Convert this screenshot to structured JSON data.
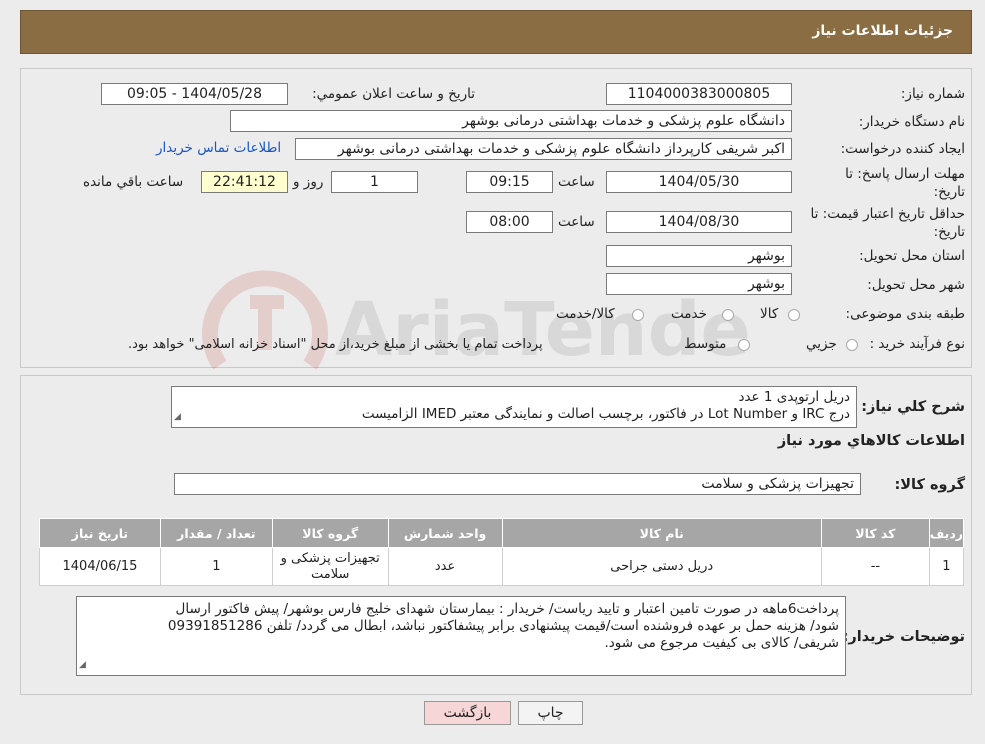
{
  "header": {
    "title": "جزئیات اطلاعات نیاز"
  },
  "form": {
    "need_number_label": "شماره نیاز:",
    "need_number": "1104000383000805",
    "announce_label": "تاریخ و ساعت اعلان عمومي:",
    "announce_value": "1404/05/28 - 09:05",
    "buyer_org_label": "نام دستگاه خريدار:",
    "buyer_org": "دانشگاه علوم پزشکی و خدمات بهداشتی درمانی بوشهر",
    "creator_label": "ايجاد كننده درخواست:",
    "creator": "اکبر شریفی کارپرداز دانشگاه علوم پزشکی و خدمات بهداشتی درمانی بوشهر",
    "contact_link": "اطلاعات تماس خريدار",
    "deadline_label_1": "مهلت ارسال پاسخ: تا",
    "deadline_label_2": "تاریخ:",
    "deadline_date": "1404/05/30",
    "time_label": "ساعت",
    "deadline_time": "09:15",
    "days_value": "1",
    "days_label": "روز و",
    "remaining_time": "22:41:12",
    "remaining_label": "ساعت باقي مانده",
    "validity_label_1": "حداقل تاریخ اعتبار قیمت: تا",
    "validity_label_2": "تاریخ:",
    "validity_date": "1404/08/30",
    "validity_time": "08:00",
    "province_label": "استان محل تحويل:",
    "province": "بوشهر",
    "city_label": "شهر محل تحويل:",
    "city": "بوشهر",
    "category_label": "طبقه بندی موضوعی:",
    "category_options": [
      "کالا",
      "خدمت",
      "کالا/خدمت"
    ],
    "process_label": "نوع فرآيند خريد :",
    "process_options": [
      "جزيي",
      "متوسط"
    ],
    "process_note": "پرداخت تمام يا بخشی از مبلغ خريد،از محل \"اسناد خزانه اسلامی\" خواهد بود."
  },
  "details": {
    "summary_label": "شرح كلي نياز:",
    "summary_lines": [
      "دریل ارتوپدی 1 عدد",
      "درج IRC و Lot Number در فاکتور، برچسب اصالت و نمایندگی معتبر IMED الزامیست"
    ],
    "goods_info_label": "اطلاعات كالاهاي مورد نياز",
    "goods_group_label": "گروه کالا:",
    "goods_group": "تجهیزات پزشکی و سلامت",
    "table": {
      "headers": [
        "رديف",
        "كد كالا",
        "نام كالا",
        "واحد شمارش",
        "گروه كالا",
        "تعداد / مقدار",
        "تاريخ نياز"
      ],
      "rows": [
        [
          "1",
          "--",
          "دریل دستی جراحی",
          "عدد",
          "تجهیزات پزشکی و سلامت",
          "1",
          "1404/06/15"
        ]
      ]
    },
    "buyer_notes_label": "توضيحات خريدار:",
    "buyer_notes_lines": [
      "پرداخت6ماهه در صورت تامین اعتبار و تایید ریاست/ خریدار : بیمارستان شهدای خلیج فارس بوشهر/ پیش فاکتور ارسال",
      "شود/ هزینه حمل بر عهده فروشنده است/قیمت پیشنهادی برابر پیشفاکتور نباشد، ابطال می گردد/ تلفن 09391851286",
      "شریفی/ کالای بی کیفیت مرجوع می شود."
    ]
  },
  "buttons": {
    "print": "چاپ",
    "back": "بازگشت"
  },
  "watermark": {
    "text": "AriaTender.neT"
  },
  "colors": {
    "header_bg": "#8b6d43",
    "table_header_bg": "#a6a6a6",
    "link": "#1a56c4",
    "back_button_bg": "#f6d6d6"
  }
}
